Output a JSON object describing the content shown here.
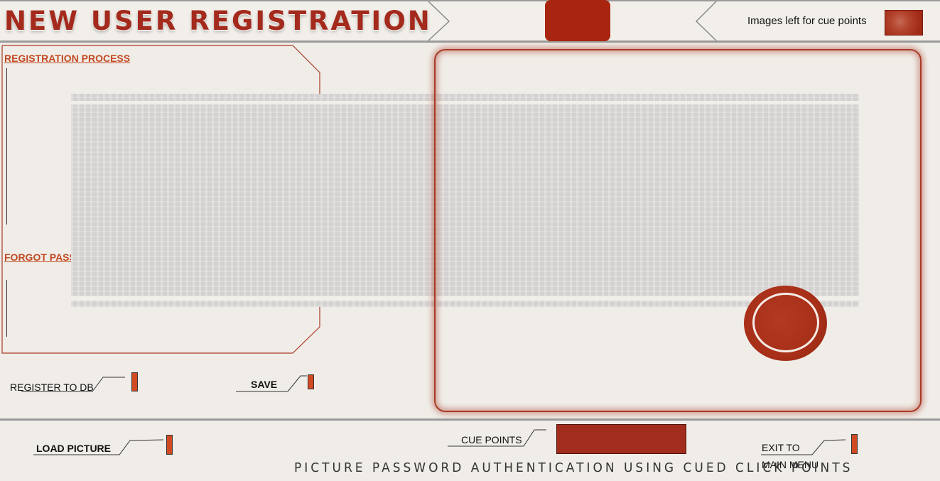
{
  "header": {
    "title": "NEW USER REGISTRATION",
    "cue_images_label": "Images left for cue points"
  },
  "left_panel": {
    "registration_link": "REGISTRATION PROCESS",
    "forgot_link": "FORGOT PASSWORD"
  },
  "actions": {
    "register_to_db": "REGISTER TO DB",
    "save": "SAVE",
    "load_picture": "LOAD PICTURE",
    "cue_points": "CUE POINTS",
    "exit_to": "EXIT TO",
    "main_menu": "MAIN MENU"
  },
  "footer": {
    "title": "PICTURE PASSWORD AUTHENTICATION USING CUED CLICK POINTS"
  },
  "colors": {
    "accent": "#a8250f",
    "link": "#c24a22",
    "background": "#f0ede8"
  }
}
